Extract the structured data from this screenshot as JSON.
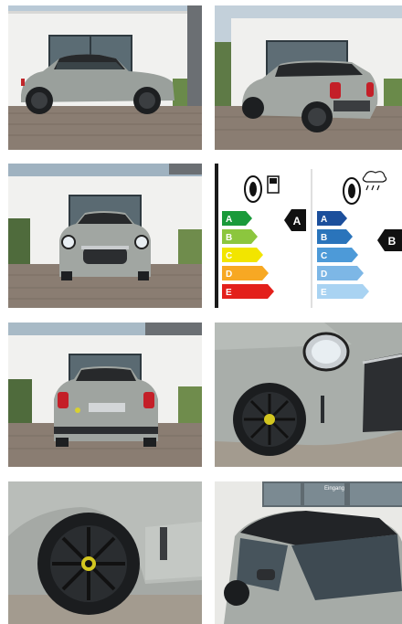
{
  "gallery": {
    "photos": [
      {
        "name": "photo-side-view"
      },
      {
        "name": "photo-rear-three-quarter"
      },
      {
        "name": "photo-front-view"
      },
      {
        "name": "tyre-energy-label"
      },
      {
        "name": "photo-rear-view"
      },
      {
        "name": "photo-headlight-wheel-detail"
      },
      {
        "name": "photo-rear-wheel-detail"
      },
      {
        "name": "photo-roof-three-quarter"
      }
    ]
  },
  "tyre_label": {
    "fuel_classes": [
      "A",
      "B",
      "C",
      "D",
      "E"
    ],
    "fuel_rating": "A",
    "wet_classes": [
      "A",
      "B",
      "C",
      "D",
      "E"
    ],
    "wet_rating": "B",
    "fuel_colors": [
      "#1a9a3a",
      "#8cc63e",
      "#f2e500",
      "#f7a823",
      "#e3201b"
    ],
    "wet_colors": [
      "#1c4f9c",
      "#2a74bb",
      "#4d9ad8",
      "#7db7e6",
      "#a9d3f2"
    ]
  },
  "showroom_sign": "Eingang"
}
